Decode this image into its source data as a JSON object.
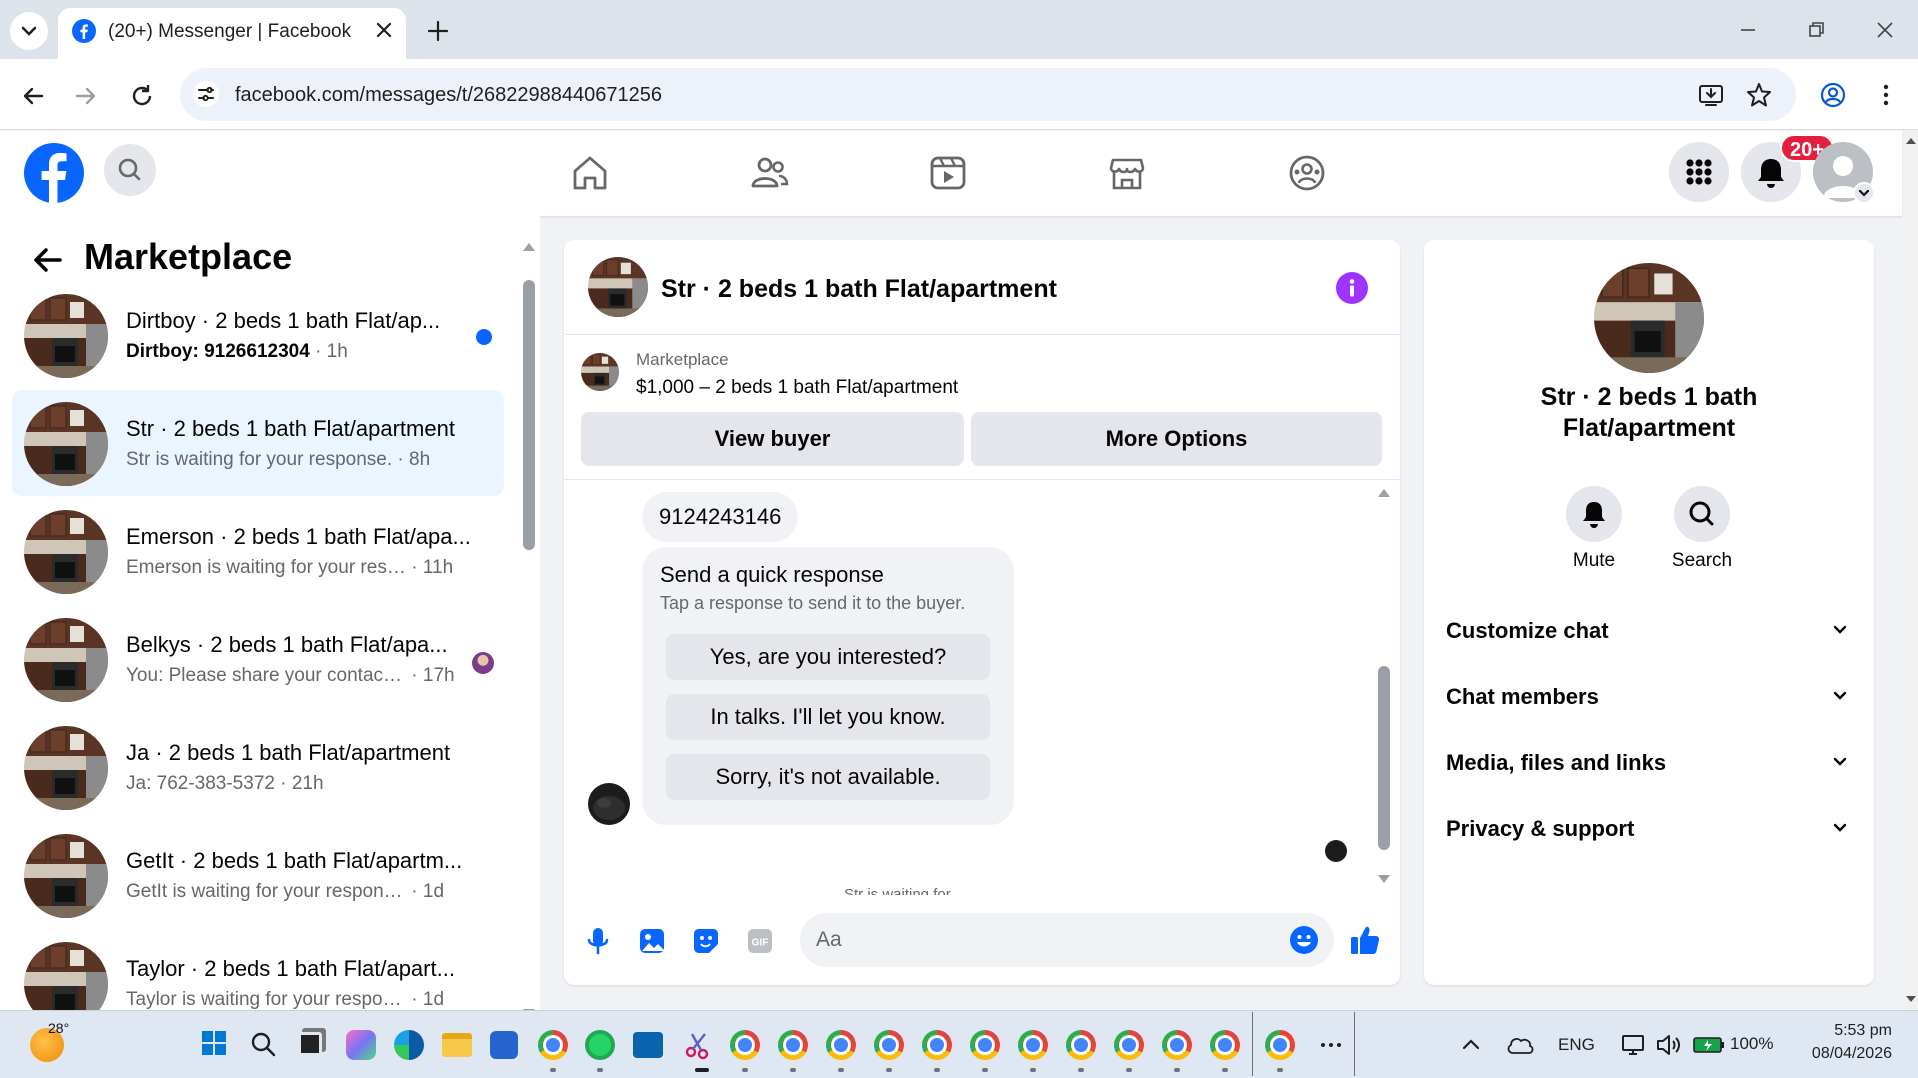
{
  "browser": {
    "tab_title": "(20+) Messenger | Facebook",
    "url": "facebook.com/messages/t/26822988440671256"
  },
  "header": {
    "notification_badge": "20+"
  },
  "sidebar": {
    "title": "Marketplace",
    "conversations": [
      {
        "name": "Dirtboy · 2 beds 1 bath Flat/ap...",
        "preview": "Dirtboy: 9126612304",
        "time": "· 1h",
        "unread": true
      },
      {
        "name": "Str · 2 beds 1 bath Flat/apartment",
        "preview": "Str is waiting for your response.",
        "time": "· 8h",
        "active": true
      },
      {
        "name": "Emerson · 2 beds 1 bath Flat/apa...",
        "preview": "Emerson is waiting for your respo...",
        "time": "· 11h"
      },
      {
        "name": "Belkys · 2 beds 1 bath Flat/apa...",
        "preview": "You: Please share your contact ...",
        "time": "· 17h"
      },
      {
        "name": "Ja · 2 beds 1 bath Flat/apartment",
        "preview": "Ja: 762-383-5372",
        "time": "· 21h"
      },
      {
        "name": "GetIt · 2 beds 1 bath Flat/apartm...",
        "preview": "GetIt is waiting for your response.",
        "time": "· 1d"
      },
      {
        "name": "Taylor · 2 beds 1 bath Flat/apart...",
        "preview": "Taylor is waiting for your response.",
        "time": "· 1d"
      }
    ]
  },
  "chat": {
    "title": "Str · 2 beds 1 bath Flat/apartment",
    "listing": {
      "label": "Marketplace",
      "text": "$1,000 – 2 beds 1 bath Flat/apartment"
    },
    "view_buyer_label": "View buyer",
    "more_options_label": "More Options",
    "messages": {
      "phone": "9124243146",
      "quick_title": "Send a quick response",
      "quick_sub": "Tap a response to send it to the buyer.",
      "responses": [
        "Yes, are you interested?",
        "In talks. I'll let you know.",
        "Sorry, it's not available."
      ],
      "cut_text": "Str is waiting for..."
    },
    "composer_placeholder": "Aa"
  },
  "info": {
    "title": "Str · 2 beds 1 bath Flat/apartment",
    "mute_label": "Mute",
    "search_label": "Search",
    "sections": [
      "Customize chat",
      "Chat members",
      "Media, files and links",
      "Privacy & support"
    ]
  },
  "taskbar": {
    "weather": "28°",
    "language": "ENG",
    "battery": "100%",
    "time": "5:53 pm",
    "date": "08/04/2026"
  },
  "colors": {
    "fb_blue": "#0866ff",
    "messenger_purple": "#a033ff",
    "active_bg": "#ebf5ff",
    "badge_red": "#e41e3f"
  }
}
